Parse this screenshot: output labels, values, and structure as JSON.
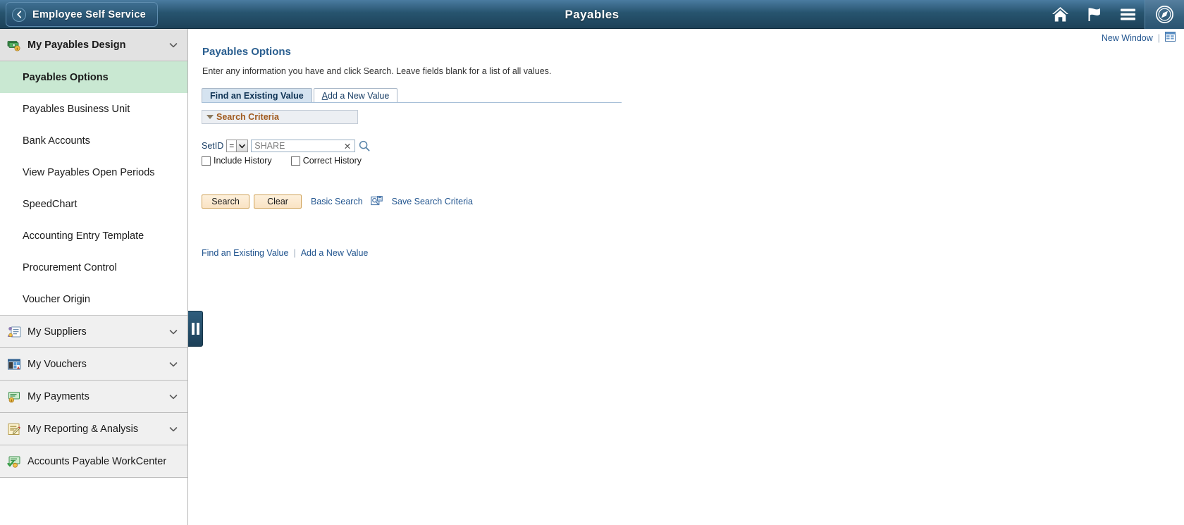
{
  "header": {
    "back_label": "Employee Self Service",
    "title": "Payables",
    "icons": [
      {
        "name": "home-icon",
        "label": "Home"
      },
      {
        "name": "flag-icon",
        "label": "Notifications"
      },
      {
        "name": "actions-menu-icon",
        "label": "Actions Menu"
      },
      {
        "name": "navbar-compass-icon",
        "label": "NavBar"
      }
    ]
  },
  "sidebar": {
    "groups": [
      {
        "label": "My Payables Design",
        "icon": "money-stack-icon",
        "expanded": true,
        "active": true,
        "items": [
          {
            "label": "Payables Options",
            "active": true
          },
          {
            "label": "Payables Business Unit",
            "active": false
          },
          {
            "label": "Bank Accounts",
            "active": false
          },
          {
            "label": "View Payables Open Periods",
            "active": false
          },
          {
            "label": "SpeedChart",
            "active": false
          },
          {
            "label": "Accounting Entry Template",
            "active": false
          },
          {
            "label": "Procurement Control",
            "active": false
          },
          {
            "label": "Voucher Origin",
            "active": false
          }
        ]
      },
      {
        "label": "My Suppliers",
        "icon": "supplier-card-icon",
        "expanded": false,
        "items": []
      },
      {
        "label": "My Vouchers",
        "icon": "voucher-grid-icon",
        "expanded": false,
        "items": []
      },
      {
        "label": "My Payments",
        "icon": "payment-check-icon",
        "expanded": false,
        "items": []
      },
      {
        "label": "My Reporting & Analysis",
        "icon": "report-pencil-icon",
        "expanded": false,
        "items": []
      },
      {
        "label": "Accounts Payable WorkCenter",
        "icon": "workcenter-icon",
        "expanded": null,
        "items": []
      }
    ],
    "collapse_handle": "pause-bars-handle"
  },
  "main": {
    "new_window_label": "New Window",
    "separator": "|",
    "personalize_icon": "grid-personalize-icon",
    "page_title": "Payables Options",
    "instructions": "Enter any information you have and click Search. Leave fields blank for a list of all values.",
    "tabs": [
      {
        "label": "Find an Existing Value",
        "active": true
      },
      {
        "label": "Add a New Value",
        "access_key": "A",
        "rest": "dd a New Value",
        "active": false
      }
    ],
    "search_criteria": {
      "heading": "Search Criteria",
      "fields": [
        {
          "label": "SetID",
          "operator": "=",
          "value": "SHARE",
          "placeholder": "SHARE",
          "clear_icon": "clear-x-icon",
          "lookup_icon": "magnifier-lookup-icon"
        }
      ],
      "checkboxes": [
        {
          "label": "Include History",
          "checked": false
        },
        {
          "label": "Correct History",
          "checked": false
        }
      ]
    },
    "actions": {
      "search_label": "Search",
      "clear_label": "Clear",
      "basic_search_label": "Basic Search",
      "save_icon": "save-search-icon",
      "save_search_label": "Save Search Criteria"
    },
    "bottom_links": [
      {
        "label": "Find an Existing Value"
      },
      {
        "label": "Add a New Value"
      }
    ],
    "bottom_separator": "|"
  },
  "colors": {
    "header_blue": "#27546f",
    "active_nav_green": "#c9e8d2",
    "link_blue": "#22558f",
    "criteria_orange": "#a05a1e",
    "button_tan": "#fae3c4"
  }
}
